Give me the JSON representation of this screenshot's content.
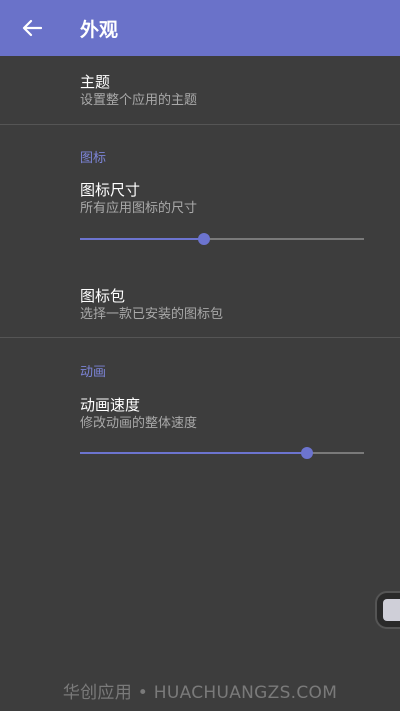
{
  "header": {
    "title": "外观",
    "back_icon": "arrow-left-icon"
  },
  "colors": {
    "appbar": "#6a72c9",
    "accent": "#6c74cf",
    "background": "#3d3d3d"
  },
  "theme": {
    "title": "主题",
    "subtitle": "设置整个应用的主题"
  },
  "icons_section": {
    "category": "图标",
    "icon_size": {
      "title": "图标尺寸",
      "subtitle": "所有应用图标的尺寸",
      "value_fraction": 0.435
    },
    "icon_pack": {
      "title": "图标包",
      "subtitle": "选择一款已安装的图标包"
    }
  },
  "animation_section": {
    "category": "动画",
    "anim_speed": {
      "title": "动画速度",
      "subtitle": "修改动画的整体速度",
      "value_fraction": 0.8
    }
  },
  "watermark": "华创应用 • HUACHUANGZS.COM"
}
